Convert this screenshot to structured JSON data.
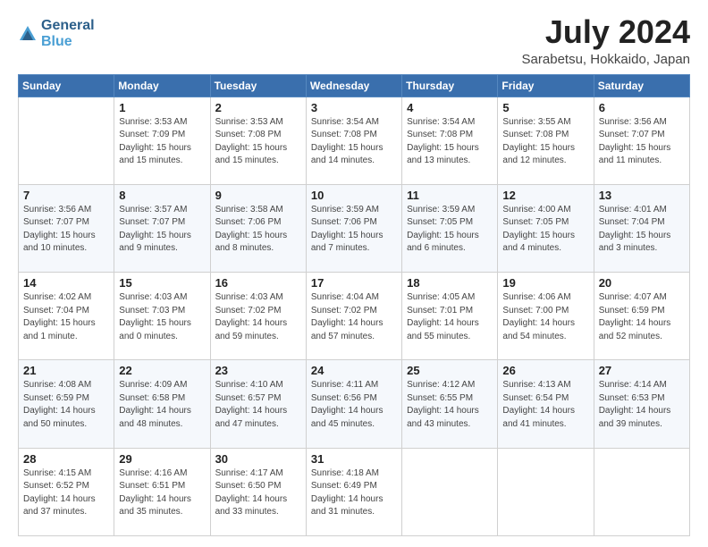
{
  "header": {
    "logo_line1": "General",
    "logo_line2": "Blue",
    "month": "July 2024",
    "location": "Sarabetsu, Hokkaido, Japan"
  },
  "days_of_week": [
    "Sunday",
    "Monday",
    "Tuesday",
    "Wednesday",
    "Thursday",
    "Friday",
    "Saturday"
  ],
  "weeks": [
    [
      {
        "day": "",
        "info": ""
      },
      {
        "day": "1",
        "info": "Sunrise: 3:53 AM\nSunset: 7:09 PM\nDaylight: 15 hours\nand 15 minutes."
      },
      {
        "day": "2",
        "info": "Sunrise: 3:53 AM\nSunset: 7:08 PM\nDaylight: 15 hours\nand 15 minutes."
      },
      {
        "day": "3",
        "info": "Sunrise: 3:54 AM\nSunset: 7:08 PM\nDaylight: 15 hours\nand 14 minutes."
      },
      {
        "day": "4",
        "info": "Sunrise: 3:54 AM\nSunset: 7:08 PM\nDaylight: 15 hours\nand 13 minutes."
      },
      {
        "day": "5",
        "info": "Sunrise: 3:55 AM\nSunset: 7:08 PM\nDaylight: 15 hours\nand 12 minutes."
      },
      {
        "day": "6",
        "info": "Sunrise: 3:56 AM\nSunset: 7:07 PM\nDaylight: 15 hours\nand 11 minutes."
      }
    ],
    [
      {
        "day": "7",
        "info": "Sunrise: 3:56 AM\nSunset: 7:07 PM\nDaylight: 15 hours\nand 10 minutes."
      },
      {
        "day": "8",
        "info": "Sunrise: 3:57 AM\nSunset: 7:07 PM\nDaylight: 15 hours\nand 9 minutes."
      },
      {
        "day": "9",
        "info": "Sunrise: 3:58 AM\nSunset: 7:06 PM\nDaylight: 15 hours\nand 8 minutes."
      },
      {
        "day": "10",
        "info": "Sunrise: 3:59 AM\nSunset: 7:06 PM\nDaylight: 15 hours\nand 7 minutes."
      },
      {
        "day": "11",
        "info": "Sunrise: 3:59 AM\nSunset: 7:05 PM\nDaylight: 15 hours\nand 6 minutes."
      },
      {
        "day": "12",
        "info": "Sunrise: 4:00 AM\nSunset: 7:05 PM\nDaylight: 15 hours\nand 4 minutes."
      },
      {
        "day": "13",
        "info": "Sunrise: 4:01 AM\nSunset: 7:04 PM\nDaylight: 15 hours\nand 3 minutes."
      }
    ],
    [
      {
        "day": "14",
        "info": "Sunrise: 4:02 AM\nSunset: 7:04 PM\nDaylight: 15 hours\nand 1 minute."
      },
      {
        "day": "15",
        "info": "Sunrise: 4:03 AM\nSunset: 7:03 PM\nDaylight: 15 hours\nand 0 minutes."
      },
      {
        "day": "16",
        "info": "Sunrise: 4:03 AM\nSunset: 7:02 PM\nDaylight: 14 hours\nand 59 minutes."
      },
      {
        "day": "17",
        "info": "Sunrise: 4:04 AM\nSunset: 7:02 PM\nDaylight: 14 hours\nand 57 minutes."
      },
      {
        "day": "18",
        "info": "Sunrise: 4:05 AM\nSunset: 7:01 PM\nDaylight: 14 hours\nand 55 minutes."
      },
      {
        "day": "19",
        "info": "Sunrise: 4:06 AM\nSunset: 7:00 PM\nDaylight: 14 hours\nand 54 minutes."
      },
      {
        "day": "20",
        "info": "Sunrise: 4:07 AM\nSunset: 6:59 PM\nDaylight: 14 hours\nand 52 minutes."
      }
    ],
    [
      {
        "day": "21",
        "info": "Sunrise: 4:08 AM\nSunset: 6:59 PM\nDaylight: 14 hours\nand 50 minutes."
      },
      {
        "day": "22",
        "info": "Sunrise: 4:09 AM\nSunset: 6:58 PM\nDaylight: 14 hours\nand 48 minutes."
      },
      {
        "day": "23",
        "info": "Sunrise: 4:10 AM\nSunset: 6:57 PM\nDaylight: 14 hours\nand 47 minutes."
      },
      {
        "day": "24",
        "info": "Sunrise: 4:11 AM\nSunset: 6:56 PM\nDaylight: 14 hours\nand 45 minutes."
      },
      {
        "day": "25",
        "info": "Sunrise: 4:12 AM\nSunset: 6:55 PM\nDaylight: 14 hours\nand 43 minutes."
      },
      {
        "day": "26",
        "info": "Sunrise: 4:13 AM\nSunset: 6:54 PM\nDaylight: 14 hours\nand 41 minutes."
      },
      {
        "day": "27",
        "info": "Sunrise: 4:14 AM\nSunset: 6:53 PM\nDaylight: 14 hours\nand 39 minutes."
      }
    ],
    [
      {
        "day": "28",
        "info": "Sunrise: 4:15 AM\nSunset: 6:52 PM\nDaylight: 14 hours\nand 37 minutes."
      },
      {
        "day": "29",
        "info": "Sunrise: 4:16 AM\nSunset: 6:51 PM\nDaylight: 14 hours\nand 35 minutes."
      },
      {
        "day": "30",
        "info": "Sunrise: 4:17 AM\nSunset: 6:50 PM\nDaylight: 14 hours\nand 33 minutes."
      },
      {
        "day": "31",
        "info": "Sunrise: 4:18 AM\nSunset: 6:49 PM\nDaylight: 14 hours\nand 31 minutes."
      },
      {
        "day": "",
        "info": ""
      },
      {
        "day": "",
        "info": ""
      },
      {
        "day": "",
        "info": ""
      }
    ]
  ]
}
